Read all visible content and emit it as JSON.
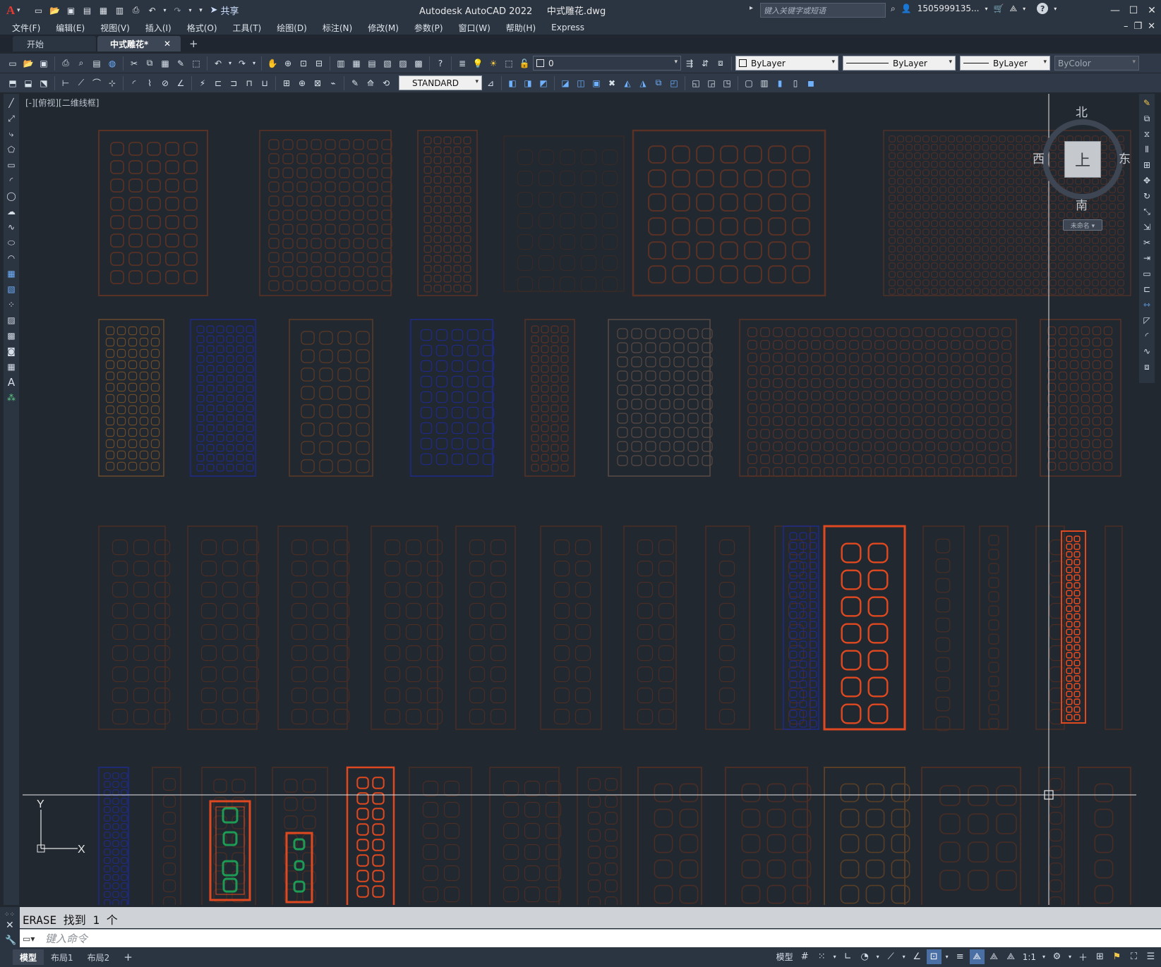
{
  "titlebar": {
    "logo": "A",
    "share_label": "共享",
    "app_title": "Autodesk AutoCAD 2022",
    "file_name": "中式雕花.dwg",
    "search_placeholder": "键入关键字或短语",
    "user_name": "1505999135...",
    "help_icon": "?"
  },
  "menu": [
    "文件(F)",
    "编辑(E)",
    "视图(V)",
    "插入(I)",
    "格式(O)",
    "工具(T)",
    "绘图(D)",
    "标注(N)",
    "修改(M)",
    "参数(P)",
    "窗口(W)",
    "帮助(H)",
    "Express"
  ],
  "tabs": {
    "start": "开始",
    "active": "中式雕花*",
    "close": "✕",
    "add": "+"
  },
  "toolbar": {
    "layer_value": "0",
    "color_value": "ByLayer",
    "linetype_value": "ByLayer",
    "lineweight_value": "ByLayer",
    "plotstyle_value": "ByColor",
    "textstyle_value": "STANDARD"
  },
  "viewport": {
    "label": "[-][俯视][二维线框]"
  },
  "viewcube": {
    "north": "北",
    "south": "南",
    "west": "西",
    "east": "东",
    "face": "上",
    "ucs_label": "未命名 ▾"
  },
  "ucs_icon": {
    "x_label": "X",
    "y_label": "Y"
  },
  "command": {
    "history": "ERASE 找到 1 个",
    "placeholder": "键入命令"
  },
  "layout_tabs": [
    "模型",
    "布局1",
    "布局2"
  ],
  "status": {
    "model_label": "模型",
    "scale_label": "1:1"
  },
  "colors": {
    "canvas_bg": "#212830",
    "pattern_brown": "#5a3225",
    "pattern_blue": "#1f2a8c",
    "pattern_orange": "#e0491f",
    "pattern_green": "#1d9a54",
    "crosshair": "#e8e8e8"
  }
}
